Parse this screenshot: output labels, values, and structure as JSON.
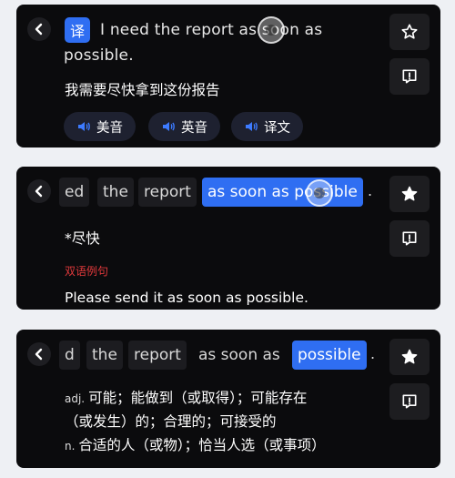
{
  "card1": {
    "translate_badge": "译",
    "en_sentence": "I need the report as soon as possible.",
    "cn_sentence": "我需要尽快拿到这份报告",
    "audio_buttons": [
      "美音",
      "英音",
      "译文"
    ]
  },
  "card2": {
    "words": [
      "ed",
      "the",
      "report",
      "as soon as possible",
      "."
    ],
    "selected_index": 3,
    "phrase": "*尽快",
    "example_label": "双语例句",
    "example_sentence": "Please send it as soon as possible."
  },
  "card3": {
    "words": [
      "d",
      "the",
      "report",
      "as soon as",
      "possible",
      "."
    ],
    "selected_index": 4,
    "definitions": [
      {
        "pos": "adj.",
        "text": "可能；能做到（或取得）；可能存在"
      },
      {
        "pos": "",
        "text": "（或发生）的；合理的；可接受的"
      },
      {
        "pos": "n.",
        "text": "合适的人（或物）；恰当人选（或事项）"
      }
    ]
  },
  "colors": {
    "accent": "#2f6ef2",
    "card_bg": "#0b0b0d",
    "example_label": "#e0393b"
  },
  "icons": {
    "back": "chevron-left",
    "favorite": "star",
    "report": "exclamation-bubble",
    "audio": "speaker"
  }
}
